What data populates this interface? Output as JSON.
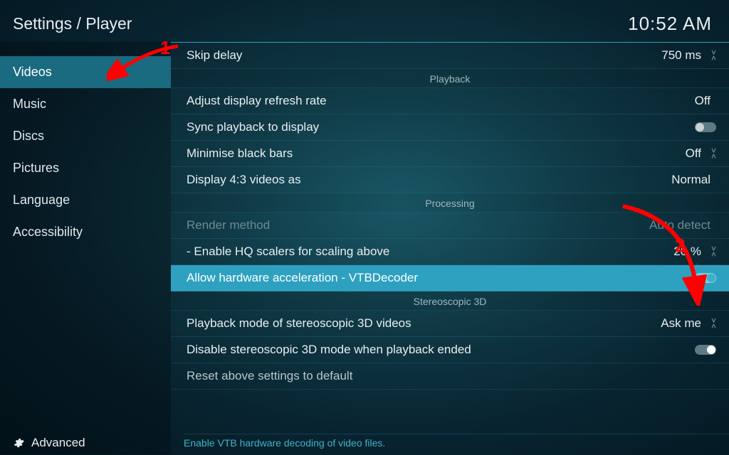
{
  "header": {
    "breadcrumb": "Settings / Player",
    "clock": "10:52 AM"
  },
  "sidebar": {
    "items": [
      {
        "label": "Videos"
      },
      {
        "label": "Music"
      },
      {
        "label": "Discs"
      },
      {
        "label": "Pictures"
      },
      {
        "label": "Language"
      },
      {
        "label": "Accessibility"
      }
    ],
    "advanced_label": "Advanced"
  },
  "groups": {
    "playback": "Playback",
    "processing": "Processing",
    "stereo": "Stereoscopic 3D"
  },
  "rows": {
    "skip_delay": {
      "label": "Skip delay",
      "value": "750 ms"
    },
    "refresh_rate": {
      "label": "Adjust display refresh rate",
      "value": "Off"
    },
    "sync_playback": {
      "label": "Sync playback to display"
    },
    "min_black_bars": {
      "label": "Minimise black bars",
      "value": "Off"
    },
    "display43": {
      "label": "Display 4:3 videos as",
      "value": "Normal"
    },
    "render_method": {
      "label": "Render method",
      "value": "Auto detect"
    },
    "hq_scalers": {
      "label": "- Enable HQ scalers for scaling above",
      "value": "20 %"
    },
    "hw_accel": {
      "label": "Allow hardware acceleration - VTBDecoder"
    },
    "stereo_mode": {
      "label": "Playback mode of stereoscopic 3D videos",
      "value": "Ask me"
    },
    "disable_stereo": {
      "label": "Disable stereoscopic 3D mode when playback ended"
    },
    "reset": {
      "label": "Reset above settings to default"
    }
  },
  "hint": "Enable VTB hardware decoding of video files.",
  "annotations": {
    "one": "1",
    "two": "2"
  }
}
